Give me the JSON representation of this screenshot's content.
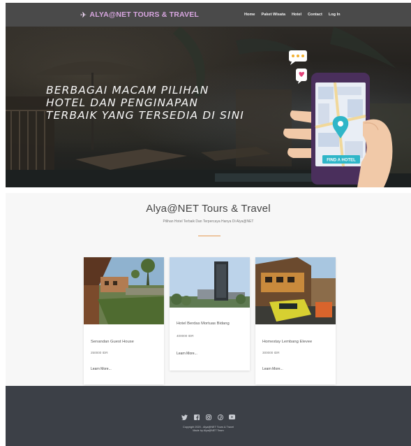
{
  "header": {
    "brand": "ALYA@NET TOURS & TRAVEL",
    "nav": [
      "Home",
      "Paket Wisata",
      "Hotel",
      "Contact",
      "Log In"
    ]
  },
  "hero": {
    "lines": [
      "BERBAGAI MACAM PILIHAN",
      "HOTEL DAN PENGINAPAN",
      "TERBAIK YANG TERSEDIA DI SINI"
    ],
    "phone_button": "FIND A HOTEL"
  },
  "main": {
    "title": "Alya@NET Tours & Travel",
    "subtitle": "Pilihan Hotel Terbaik Dan Terpercaya Hanya Di Alya@NET",
    "cards": [
      {
        "name": "Senandan Guest House",
        "price": "250000 IDR",
        "link": "Learn More..."
      },
      {
        "name": "Hotel Berdas Mortuas Bidang",
        "price": "400000 IDR",
        "link": "Learn More..."
      },
      {
        "name": "Homestay Lembang Elevee",
        "price": "300000 IDR",
        "link": "Learn More..."
      }
    ]
  },
  "footer": {
    "icons": [
      "twitter-icon",
      "facebook-icon",
      "instagram-icon",
      "pinterest-icon",
      "youtube-icon"
    ],
    "copyright": "Copyright 2020 - Alya@NET Tours & Travel",
    "credit": "Made by Alya@NET Team"
  },
  "colors": {
    "header_bg": "#4a4a4a",
    "brand": "#d8a6e0",
    "accent": "#e59a52",
    "footer_bg": "#3c4047"
  }
}
